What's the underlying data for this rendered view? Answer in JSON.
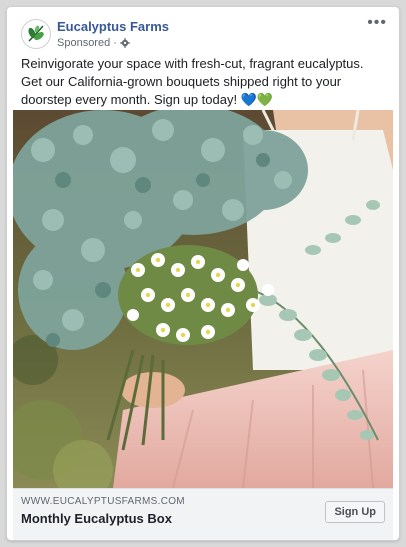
{
  "ad": {
    "page_name": "Eucalyptus Farms",
    "sponsored_label": "Sponsored",
    "separator": "·",
    "more_label": "•••",
    "body_text": "Reinvigorate your space with fresh-cut, fragrant eucalyptus. Get our California-grown bouquets shipped right to your doorstep every month. Sign up today! 💙💚"
  },
  "link_preview": {
    "domain": "WWW.EUCALYPTUSFARMS.COM",
    "headline": "Monthly Eucalyptus Box",
    "cta_label": "Sign Up"
  },
  "colors": {
    "page_name": "#385898",
    "logo_green": "#2e7d32",
    "eucalyptus": "#7fa39a",
    "dress_pink": "#e9b6ad"
  },
  "icons": {
    "avatar": "eucalyptus-leaf-logo-icon",
    "privacy": "gear-icon",
    "more": "more-options-icon"
  }
}
